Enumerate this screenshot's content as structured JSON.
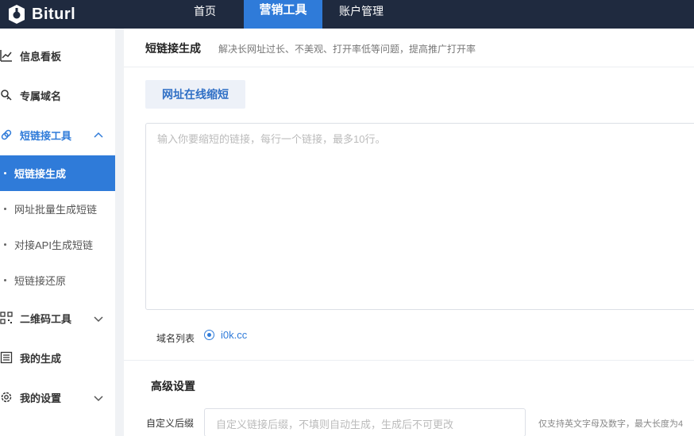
{
  "brand": {
    "name": "Biturl",
    "accent": "#2f7bd9",
    "topbar_bg": "#1f2a3f"
  },
  "nav": {
    "home": "首页",
    "marketing": "营销工具",
    "account": "账户管理"
  },
  "sidebar": {
    "dashboard": {
      "label": "信息看板",
      "icon": "chart-icon"
    },
    "domains": {
      "label": "专属域名",
      "icon": "key-icon"
    },
    "shortlink_group": {
      "label": "短链接工具",
      "icon": "link-icon",
      "expanded": true
    },
    "sub_items": [
      {
        "label": "短链接生成",
        "selected": true
      },
      {
        "label": "网址批量生成短链",
        "selected": false
      },
      {
        "label": "对接API生成短链",
        "selected": false
      },
      {
        "label": "短链接还原",
        "selected": false
      }
    ],
    "qrcode": {
      "label": "二维码工具",
      "icon": "qrcode-icon"
    },
    "my_generated": {
      "label": "我的生成",
      "icon": "list-icon"
    },
    "settings": {
      "label": "我的设置",
      "icon": "gear-icon"
    }
  },
  "page": {
    "title": "短链接生成",
    "description": "解决长网址过长、不美观、打开率低等问题，提高推广打开率",
    "tab_label": "网址在线缩短",
    "input_placeholder": "输入你要缩短的链接，每行一个链接，最多10行。",
    "domain_list_label": "域名列表",
    "domain_option": "i0k.cc",
    "advanced_title": "高级设置",
    "suffix_label": "自定义后缀",
    "suffix_placeholder": "自定义链接后缀，不填则自动生成，生成后不可更改",
    "suffix_hint": "仅支持英文字母及数字，最大长度为4"
  }
}
